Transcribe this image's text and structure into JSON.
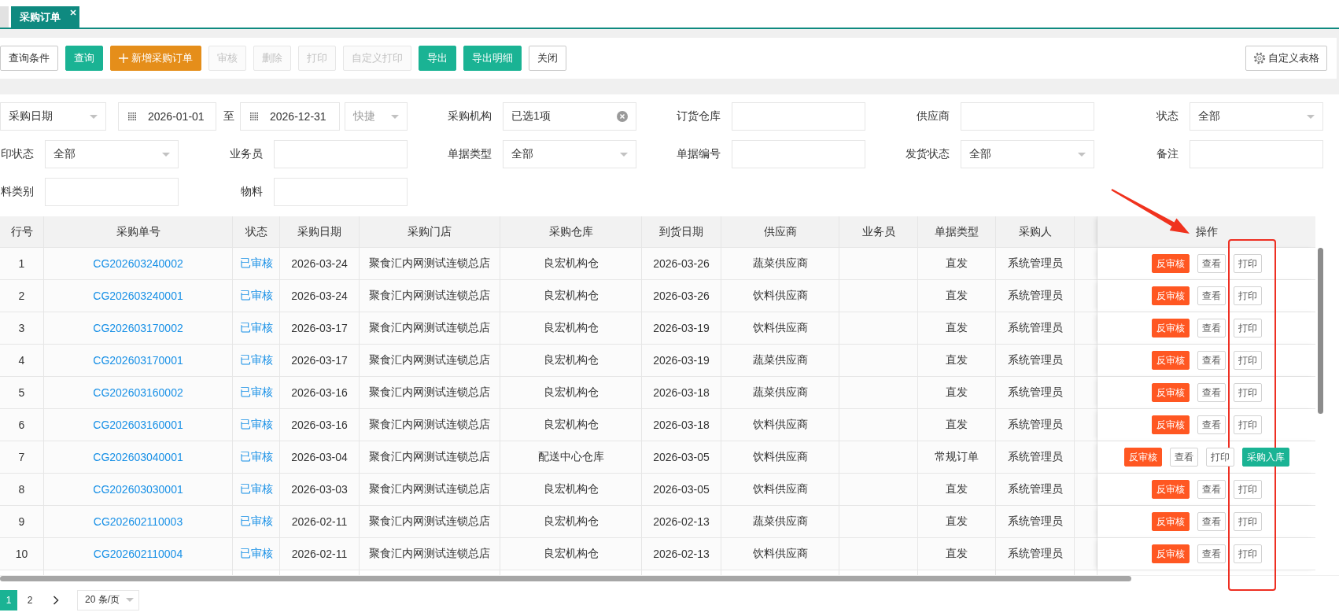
{
  "tabs": [
    {
      "selected": false,
      "closable": false
    },
    {
      "label": "采购订单",
      "selected": true,
      "closable": true
    }
  ],
  "toolbar": {
    "buttons": [
      {
        "label": "查询条件",
        "kind": "outline",
        "disabled": false
      },
      {
        "label": "查询",
        "kind": "primary",
        "disabled": false
      },
      {
        "label": "新增采购订单",
        "kind": "add",
        "disabled": false
      },
      {
        "label": "审核",
        "kind": "outline",
        "disabled": true
      },
      {
        "label": "删除",
        "kind": "outline",
        "disabled": true
      },
      {
        "label": "打印",
        "kind": "outline",
        "disabled": true
      },
      {
        "label": "自定义打印",
        "kind": "outline",
        "disabled": true
      },
      {
        "label": "导出",
        "kind": "primary",
        "disabled": false
      },
      {
        "label": "导出明细",
        "kind": "primary",
        "disabled": false
      },
      {
        "label": "关闭",
        "kind": "outline",
        "disabled": false
      }
    ],
    "settings_button": {
      "label": "自定义表格"
    }
  },
  "filters": {
    "date_range": {
      "type": {
        "value": "采购日期"
      },
      "start": "2026-01-01",
      "separator": "至",
      "end": "2026-12-31",
      "quick": {
        "placeholder": "快捷"
      }
    },
    "fields": [
      {
        "label": "采购机构",
        "kind": "picker",
        "value": "已选1项"
      },
      {
        "label": "订货仓库",
        "kind": "input"
      },
      {
        "label": "供应商",
        "kind": "input"
      },
      {
        "label": "状态",
        "kind": "select",
        "value": "全部"
      },
      {
        "label": "印状态",
        "kind": "select",
        "value": "全部"
      },
      {
        "label": "业务员",
        "kind": "input"
      },
      {
        "label": "单据类型",
        "kind": "select",
        "value": "全部"
      },
      {
        "label": "单据编号",
        "kind": "input"
      },
      {
        "label": "发货状态",
        "kind": "select",
        "value": "全部"
      },
      {
        "label": "备注",
        "kind": "input"
      },
      {
        "label": "料类别",
        "kind": "input"
      },
      {
        "label": "物料",
        "kind": "input"
      }
    ]
  },
  "table": {
    "columns": [
      "行号",
      "采购单号",
      "状态",
      "采购日期",
      "采购门店",
      "采购仓库",
      "到货日期",
      "供应商",
      "业务员",
      "单据类型",
      "采购人",
      "操作"
    ],
    "rows": [
      {
        "no": "1",
        "order_no": "CG202603240002",
        "status": "已审核",
        "order_date": "2026-03-24",
        "store": "聚食汇内网测试连锁总店",
        "warehouse": "良宏机构仓",
        "arrival_date": "2026-03-26",
        "supplier": "蔬菜供应商",
        "doc_type": "直发",
        "buyer": "系统管理员",
        "actions": [
          {
            "label": "反审核",
            "kind": "unaudit"
          },
          {
            "label": "查看",
            "kind": "view"
          },
          {
            "label": "打印",
            "kind": "print"
          }
        ]
      },
      {
        "no": "2",
        "order_no": "CG202603240001",
        "status": "已审核",
        "order_date": "2026-03-24",
        "store": "聚食汇内网测试连锁总店",
        "warehouse": "良宏机构仓",
        "arrival_date": "2026-03-26",
        "supplier": "饮料供应商",
        "doc_type": "直发",
        "buyer": "系统管理员",
        "actions": [
          {
            "label": "反审核",
            "kind": "unaudit"
          },
          {
            "label": "查看",
            "kind": "view"
          },
          {
            "label": "打印",
            "kind": "print"
          }
        ]
      },
      {
        "no": "3",
        "order_no": "CG202603170002",
        "status": "已审核",
        "order_date": "2026-03-17",
        "store": "聚食汇内网测试连锁总店",
        "warehouse": "良宏机构仓",
        "arrival_date": "2026-03-19",
        "supplier": "饮料供应商",
        "doc_type": "直发",
        "buyer": "系统管理员",
        "actions": [
          {
            "label": "反审核",
            "kind": "unaudit"
          },
          {
            "label": "查看",
            "kind": "view"
          },
          {
            "label": "打印",
            "kind": "print"
          }
        ]
      },
      {
        "no": "4",
        "order_no": "CG202603170001",
        "status": "已审核",
        "order_date": "2026-03-17",
        "store": "聚食汇内网测试连锁总店",
        "warehouse": "良宏机构仓",
        "arrival_date": "2026-03-19",
        "supplier": "蔬菜供应商",
        "doc_type": "直发",
        "buyer": "系统管理员",
        "actions": [
          {
            "label": "反审核",
            "kind": "unaudit"
          },
          {
            "label": "查看",
            "kind": "view"
          },
          {
            "label": "打印",
            "kind": "print"
          }
        ]
      },
      {
        "no": "5",
        "order_no": "CG202603160002",
        "status": "已审核",
        "order_date": "2026-03-16",
        "store": "聚食汇内网测试连锁总店",
        "warehouse": "良宏机构仓",
        "arrival_date": "2026-03-18",
        "supplier": "蔬菜供应商",
        "doc_type": "直发",
        "buyer": "系统管理员",
        "actions": [
          {
            "label": "反审核",
            "kind": "unaudit"
          },
          {
            "label": "查看",
            "kind": "view"
          },
          {
            "label": "打印",
            "kind": "print"
          }
        ]
      },
      {
        "no": "6",
        "order_no": "CG202603160001",
        "status": "已审核",
        "order_date": "2026-03-16",
        "store": "聚食汇内网测试连锁总店",
        "warehouse": "良宏机构仓",
        "arrival_date": "2026-03-18",
        "supplier": "饮料供应商",
        "doc_type": "直发",
        "buyer": "系统管理员",
        "actions": [
          {
            "label": "反审核",
            "kind": "unaudit"
          },
          {
            "label": "查看",
            "kind": "view"
          },
          {
            "label": "打印",
            "kind": "print"
          }
        ]
      },
      {
        "no": "7",
        "order_no": "CG202603040001",
        "status": "已审核",
        "order_date": "2026-03-04",
        "store": "聚食汇内网测试连锁总店",
        "warehouse": "配送中心仓库",
        "arrival_date": "2026-03-05",
        "supplier": "饮料供应商",
        "doc_type": "常规订单",
        "buyer": "系统管理员",
        "actions": [
          {
            "label": "反审核",
            "kind": "unaudit"
          },
          {
            "label": "查看",
            "kind": "view"
          },
          {
            "label": "打印",
            "kind": "print"
          },
          {
            "label": "采购入库",
            "kind": "receive"
          }
        ]
      },
      {
        "no": "8",
        "order_no": "CG202603030001",
        "status": "已审核",
        "order_date": "2026-03-03",
        "store": "聚食汇内网测试连锁总店",
        "warehouse": "良宏机构仓",
        "arrival_date": "2026-03-05",
        "supplier": "饮料供应商",
        "doc_type": "直发",
        "buyer": "系统管理员",
        "actions": [
          {
            "label": "反审核",
            "kind": "unaudit"
          },
          {
            "label": "查看",
            "kind": "view"
          },
          {
            "label": "打印",
            "kind": "print"
          }
        ]
      },
      {
        "no": "9",
        "order_no": "CG202602110003",
        "status": "已审核",
        "order_date": "2026-02-11",
        "store": "聚食汇内网测试连锁总店",
        "warehouse": "良宏机构仓",
        "arrival_date": "2026-02-13",
        "supplier": "蔬菜供应商",
        "doc_type": "直发",
        "buyer": "系统管理员",
        "actions": [
          {
            "label": "反审核",
            "kind": "unaudit"
          },
          {
            "label": "查看",
            "kind": "view"
          },
          {
            "label": "打印",
            "kind": "print"
          }
        ]
      },
      {
        "no": "10",
        "order_no": "CG202602110004",
        "status": "已审核",
        "order_date": "2026-02-11",
        "store": "聚食汇内网测试连锁总店",
        "warehouse": "良宏机构仓",
        "arrival_date": "2026-02-13",
        "supplier": "饮料供应商",
        "doc_type": "直发",
        "buyer": "系统管理员",
        "actions": [
          {
            "label": "反审核",
            "kind": "unaudit"
          },
          {
            "label": "查看",
            "kind": "view"
          },
          {
            "label": "打印",
            "kind": "print"
          }
        ]
      }
    ]
  },
  "pagination": {
    "pages": [
      {
        "label": "1",
        "selected": true
      },
      {
        "label": "2",
        "selected": false
      }
    ],
    "page_size": "20 条/页"
  }
}
